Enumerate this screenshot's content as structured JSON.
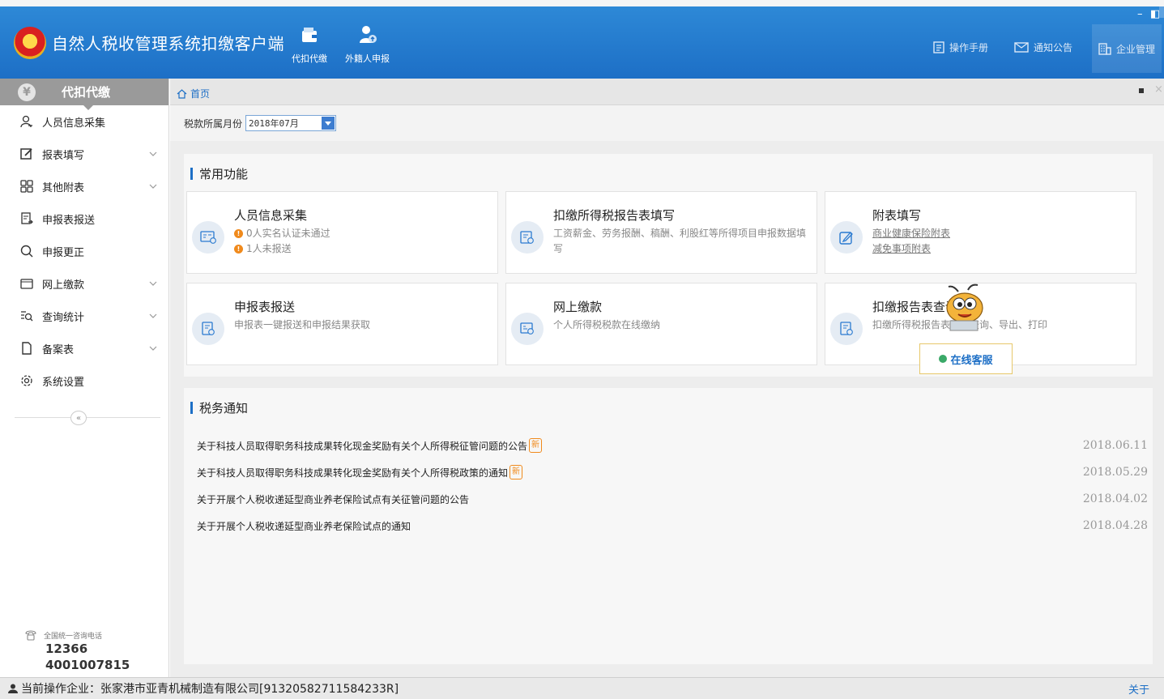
{
  "app": {
    "title": "自然人税收管理系统扣缴客户端"
  },
  "top_nav": [
    {
      "label": "代扣代缴"
    },
    {
      "label": "外籍人申报"
    }
  ],
  "top_right": {
    "manual": "操作手册",
    "notice": "通知公告",
    "company": "企业管理"
  },
  "window_controls": {
    "minimize": "–",
    "restore": "◧"
  },
  "sidebar": {
    "header": "代扣代缴",
    "header_icon": "¥",
    "items": [
      {
        "label": "人员信息采集",
        "icon": "person-icon",
        "expandable": false
      },
      {
        "label": "报表填写",
        "icon": "edit-icon",
        "expandable": true
      },
      {
        "label": "其他附表",
        "icon": "grid-icon",
        "expandable": true
      },
      {
        "label": "申报表报送",
        "icon": "send-report-icon",
        "expandable": false
      },
      {
        "label": "申报更正",
        "icon": "search-icon",
        "expandable": false
      },
      {
        "label": "网上缴款",
        "icon": "wallet-icon",
        "expandable": true
      },
      {
        "label": "查询统计",
        "icon": "query-icon",
        "expandable": true
      },
      {
        "label": "备案表",
        "icon": "file-icon",
        "expandable": true
      },
      {
        "label": "系统设置",
        "icon": "gear-icon",
        "expandable": false
      }
    ],
    "collapse_label": "«",
    "hotline_label": "全国统一咨询电话",
    "hotline_numbers": [
      "12366",
      "4001007815"
    ]
  },
  "tabbar": {
    "home_label": "首页"
  },
  "month": {
    "label": "税款所属月份",
    "value": "2018年07月"
  },
  "common": {
    "title": "常用功能",
    "cards": [
      {
        "title": "人员信息采集",
        "warnings": [
          "0人实名认证未通过",
          "1人未报送"
        ],
        "icon": "id-card-icon"
      },
      {
        "title": "扣缴所得税报告表填写",
        "sub": "工资薪金、劳务报酬、稿酬、利股红等所得项目申报数据填写",
        "icon": "tax-form-icon"
      },
      {
        "title": "附表填写",
        "links": [
          "商业健康保险附表",
          "减免事项附表"
        ],
        "icon": "pencil-icon"
      },
      {
        "title": "申报表报送",
        "sub": "申报表一键报送和申报结果获取",
        "icon": "report-send-icon"
      },
      {
        "title": "网上缴款",
        "sub": "个人所得税税款在线缴纳",
        "icon": "payment-icon"
      },
      {
        "title": "扣缴报告表查询",
        "sub": "扣缴所得税报告表数据查询、导出、打印",
        "icon": "report-query-icon"
      }
    ]
  },
  "notices": {
    "title": "税务通知",
    "new_badge": "新",
    "items": [
      {
        "text": "关于科技人员取得职务科技成果转化现金奖励有关个人所得税征管问题的公告",
        "date": "2018.06.11",
        "is_new": true
      },
      {
        "text": "关于科技人员取得职务科技成果转化现金奖励有关个人所得税政策的通知",
        "date": "2018.05.29",
        "is_new": true
      },
      {
        "text": "关于开展个人税收递延型商业养老保险试点有关征管问题的公告",
        "date": "2018.04.02",
        "is_new": false
      },
      {
        "text": "关于开展个人税收递延型商业养老保险试点的通知",
        "date": "2018.04.28",
        "is_new": false
      }
    ]
  },
  "online_service": "在线客服",
  "status": {
    "company": "当前操作企业：张家港市亚青机械制造有限公司[91320582711584233R]",
    "close": "关于"
  },
  "colors": {
    "brand_blue": "#1d6fc6",
    "sidebar_header": "#9a9a9a",
    "warning_orange": "#f08a1c"
  }
}
